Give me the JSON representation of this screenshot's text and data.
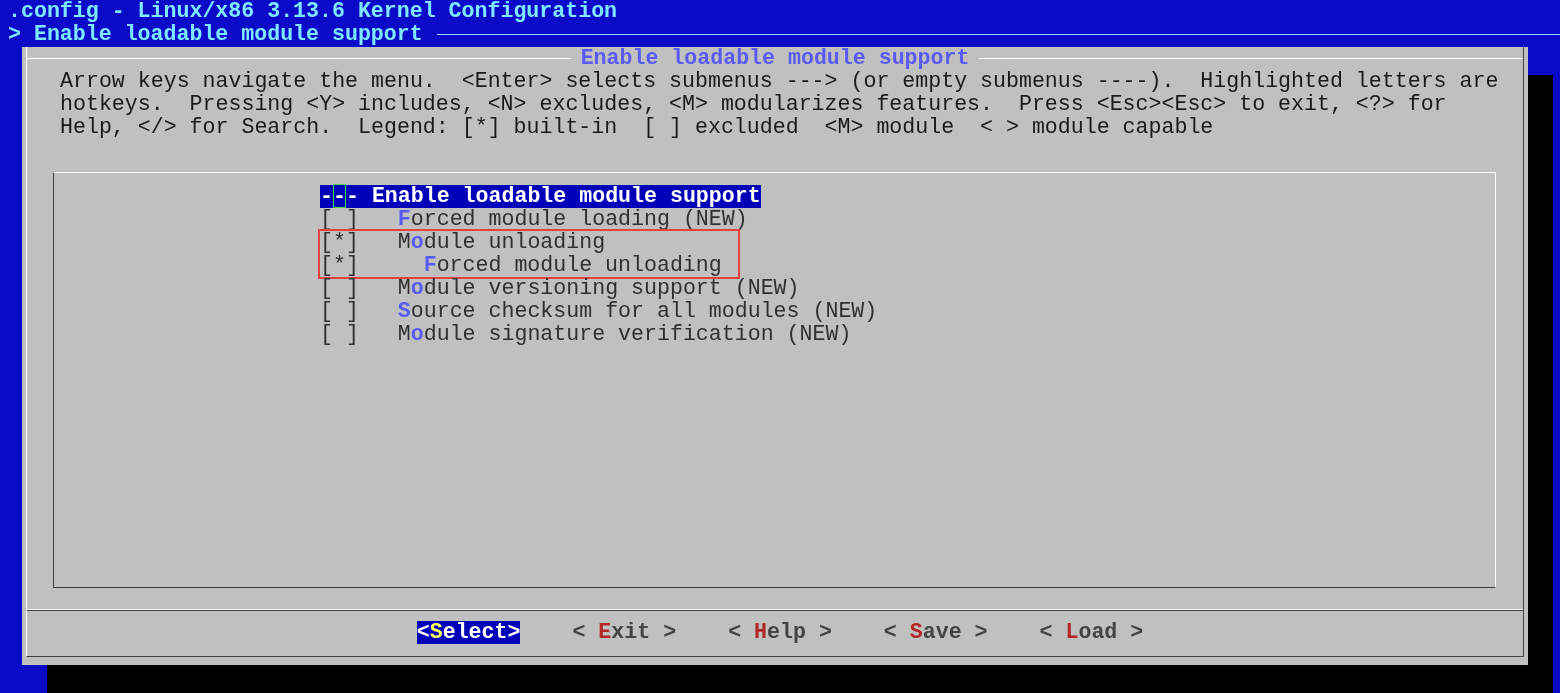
{
  "window": {
    "title": ".config - Linux/x86 3.13.6 Kernel Configuration"
  },
  "breadcrumb": "> Enable loadable module support",
  "dialog": {
    "title": "Enable loadable module support",
    "help_lines": [
      "Arrow keys navigate the menu.  <Enter> selects submenus ---> (or empty submenus ----).  Highlighted letters are",
      "hotkeys.  Pressing <Y> includes, <N> excludes, <M> modularizes features.  Press <Esc><Esc> to exit, <?> for",
      "Help, </> for Search.  Legend: [*] built-in  [ ] excluded  <M> module  < > module capable"
    ],
    "menu": [
      {
        "kind": "header",
        "box": "---",
        "rest": "Enable loadable module support",
        "selected": true,
        "annotated": false
      },
      {
        "kind": "option",
        "box": "[ ]",
        "hotkey": "F",
        "rest": "orced module loading (NEW)",
        "selected": false,
        "annotated": false
      },
      {
        "kind": "option",
        "box": "[*]",
        "lead": "M",
        "hotkey": "o",
        "rest": "dule unloading",
        "selected": false,
        "annotated": true,
        "children": [
          {
            "kind": "option",
            "box": "[*]",
            "hotkey": "F",
            "rest": "orced module unloading",
            "selected": false,
            "annotated": false
          }
        ]
      },
      {
        "kind": "option",
        "box": "[ ]",
        "lead": "M",
        "hotkey": "o",
        "rest": "dule versioning support (NEW)",
        "selected": false,
        "annotated": false
      },
      {
        "kind": "option",
        "box": "[ ]",
        "hotkey": "S",
        "rest": "ource checksum for all modules (NEW)",
        "selected": false,
        "annotated": false
      },
      {
        "kind": "option",
        "box": "[ ]",
        "lead": "M",
        "hotkey": "o",
        "rest": "dule signature verification (NEW)",
        "selected": false,
        "annotated": false
      }
    ],
    "buttons": [
      {
        "prefix": "<",
        "hotkey": "S",
        "rest": "elect",
        "suffix": ">",
        "selected": true
      },
      {
        "prefix": "< ",
        "hotkey": "E",
        "rest": "xit",
        "suffix": " >",
        "selected": false
      },
      {
        "prefix": "< ",
        "hotkey": "H",
        "rest": "elp",
        "suffix": " >",
        "selected": false
      },
      {
        "prefix": "< ",
        "hotkey": "S",
        "rest": "ave",
        "suffix": " >",
        "selected": false
      },
      {
        "prefix": "< ",
        "hotkey": "L",
        "rest": "oad",
        "suffix": " >",
        "selected": false
      }
    ]
  }
}
